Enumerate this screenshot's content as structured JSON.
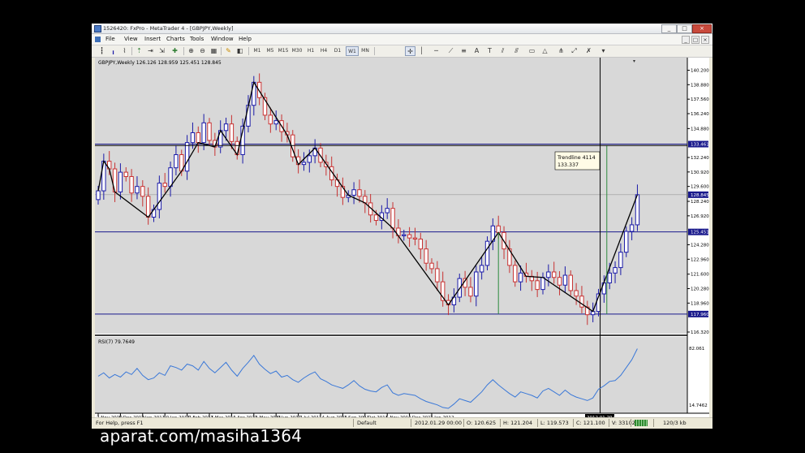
{
  "window": {
    "title": "1526420: FxPro - MetaTrader 4 - [GBPJPY,Weekly]",
    "controls": [
      "_",
      "□",
      "×"
    ]
  },
  "menu": [
    "File",
    "View",
    "Insert",
    "Charts",
    "Tools",
    "Window",
    "Help"
  ],
  "toolbar": {
    "timeframes": [
      "M1",
      "M5",
      "M15",
      "M30",
      "H1",
      "H4",
      "D1",
      "W1",
      "MN"
    ],
    "active_timeframe": "W1"
  },
  "chart": {
    "symbol_header": "GBPJPY,Weekly  126.126 128.959 125.451 128.845",
    "price_labels": [
      "140.200",
      "138.880",
      "137.560",
      "136.240",
      "134.880",
      "133.461",
      "132.240",
      "130.920",
      "129.600",
      "128.845",
      "128.240",
      "126.920",
      "125.451",
      "124.280",
      "122.960",
      "121.600",
      "120.280",
      "118.960",
      "117.960",
      "116.320"
    ],
    "price_label_values": [
      140.2,
      138.88,
      137.56,
      136.24,
      134.88,
      133.461,
      132.24,
      130.92,
      129.6,
      128.845,
      128.24,
      126.92,
      125.451,
      124.28,
      122.96,
      121.6,
      120.28,
      118.96,
      117.96,
      116.32
    ],
    "highlighted_price_labels": [
      "133.461",
      "128.845",
      "125.451",
      "117.960"
    ],
    "trendline_tooltip": [
      "Trendline 4114",
      "133.337"
    ],
    "rsi_header": "RSI(7) 79.7649",
    "rsi_levels": [
      "82.061",
      "14.7462"
    ],
    "date_labels": [
      "7 Nov 2010",
      "5 Dec 2010",
      "2 Jan 2011",
      "30 Jan 2011",
      "27 Feb 2011",
      "27 Mar 2011",
      "24 Apr 2011",
      "22 May 2011",
      "19 Jun 2011",
      "17 Jul 2011",
      "14 Aug 2011",
      "11 Sep 2011",
      "9 Oct 2011",
      "6 Nov 2011",
      "4 Dec 2011",
      "1 Jan 2012"
    ],
    "crosshair_date_label": "2012.01.29 00:00",
    "candle_colors": {
      "bull": "#1a1aa8",
      "bear": "#c83232"
    },
    "level_line_color": "#1a1a8c",
    "marker_line_color": "#2e8b3e"
  },
  "chart_data": {
    "type": "candlestick",
    "symbol": "GBPJPY",
    "timeframe": "Weekly",
    "ylim": [
      116.32,
      141.2
    ],
    "horizontal_levels": [
      133.461,
      125.451,
      117.96
    ],
    "crosshair": {
      "date": "2012.01.29 00:00",
      "price": 133.337
    },
    "close": [
      129.2,
      131.9,
      131.2,
      129.1,
      130.9,
      130.5,
      129.0,
      129.6,
      128.7,
      126.8,
      127.5,
      129.9,
      129.6,
      131.3,
      132.5,
      131.0,
      133.6,
      134.5,
      133.6,
      135.4,
      133.8,
      133.2,
      134.7,
      135.3,
      133.7,
      132.5,
      135.1,
      137.0,
      139.1,
      137.7,
      136.1,
      135.3,
      135.6,
      134.6,
      134.3,
      132.3,
      131.6,
      131.8,
      132.4,
      133.1,
      131.8,
      131.4,
      130.2,
      129.6,
      128.6,
      128.8,
      129.3,
      128.7,
      128.1,
      127.0,
      126.5,
      127.2,
      127.6,
      125.8,
      125.1,
      125.2,
      124.9,
      124.8,
      123.9,
      122.6,
      122.1,
      120.9,
      119.2,
      118.8,
      119.5,
      121.2,
      120.4,
      119.6,
      121.8,
      122.4,
      124.6,
      126.0,
      125.4,
      123.9,
      122.4,
      120.9,
      121.7,
      121.4,
      121.0,
      120.2,
      121.3,
      121.8,
      121.3,
      120.6,
      121.5,
      120.1,
      119.6,
      118.6,
      117.9,
      118.2,
      119.8,
      120.8,
      121.7,
      122.2,
      123.6,
      125.5,
      126.1,
      128.845
    ],
    "rsi": [
      48,
      52,
      46,
      50,
      47,
      53,
      50,
      57,
      49,
      44,
      46,
      52,
      49,
      60,
      58,
      55,
      62,
      60,
      55,
      65,
      57,
      52,
      58,
      64,
      55,
      48,
      57,
      64,
      72,
      62,
      56,
      51,
      54,
      47,
      49,
      44,
      41,
      46,
      50,
      53,
      45,
      42,
      38,
      36,
      34,
      38,
      43,
      37,
      33,
      31,
      30,
      35,
      38,
      29,
      26,
      28,
      27,
      26,
      22,
      19,
      17,
      15,
      12,
      11,
      16,
      22,
      20,
      18,
      24,
      30,
      38,
      44,
      38,
      33,
      28,
      24,
      30,
      28,
      26,
      23,
      31,
      34,
      30,
      26,
      32,
      27,
      24,
      22,
      20,
      23,
      33,
      37,
      42,
      43,
      49,
      58,
      67,
      79.7649
    ],
    "rsi_range": [
      14.7462,
      82.061
    ]
  },
  "status": {
    "help": "For Help, press F1",
    "profile": "Default",
    "datetime": "2012.01.29 00:00",
    "open": "O: 120.625",
    "high": "H: 121.204",
    "low": "L: 119.573",
    "close": "C: 121.100",
    "volume": "V: 331026",
    "traffic": "120/3 kb"
  },
  "watermark": "aparat.com/masiha1364"
}
